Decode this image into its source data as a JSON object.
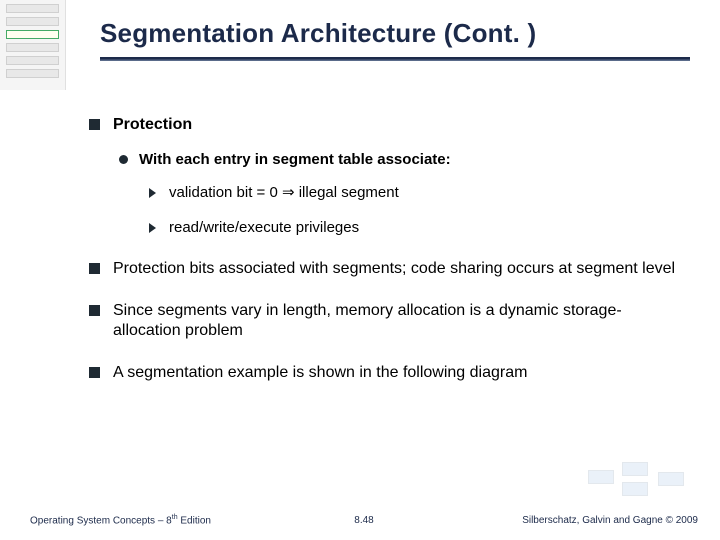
{
  "title": "Segmentation Architecture (Cont. )",
  "bullets": {
    "b1": "Protection",
    "b1_sub": "With each entry in segment table associate:",
    "b1_sub_a": "validation bit = 0 ⇒ illegal segment",
    "b1_sub_b": "read/write/execute privileges",
    "b2": "Protection bits associated with segments; code sharing occurs at segment level",
    "b3": "Since segments vary in length, memory allocation is a dynamic storage-allocation problem",
    "b4": "A segmentation example is shown in the following diagram"
  },
  "footer": {
    "left_a": "Operating System Concepts – 8",
    "left_sup": "th",
    "left_b": " Edition",
    "center": "8.48",
    "right": "Silberschatz, Galvin and Gagne © 2009"
  }
}
